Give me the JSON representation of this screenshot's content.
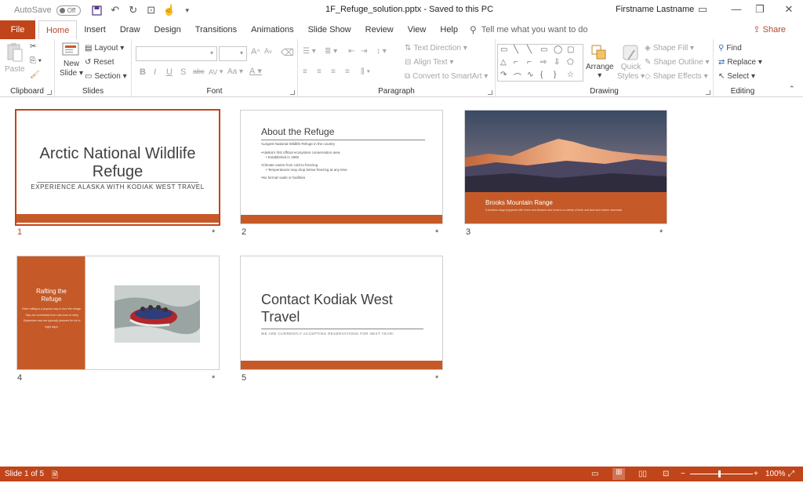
{
  "window": {
    "autosave_label": "AutoSave",
    "autosave_state": "Off",
    "document_title": "1F_Refuge_solution.pptx  -  Saved to this PC",
    "user_name": "Firstname Lastname"
  },
  "tabs": {
    "file": "File",
    "home": "Home",
    "insert": "Insert",
    "draw": "Draw",
    "design": "Design",
    "transitions": "Transitions",
    "animations": "Animations",
    "slideshow": "Slide Show",
    "review": "Review",
    "view": "View",
    "help": "Help",
    "tell_me": "Tell me what you want to do",
    "share": "Share"
  },
  "ribbon": {
    "clipboard": {
      "label": "Clipboard",
      "paste": "Paste"
    },
    "slides": {
      "label": "Slides",
      "new_slide_1": "New",
      "new_slide_2": "Slide",
      "layout": "Layout",
      "reset": "Reset",
      "section": "Section"
    },
    "font": {
      "label": "Font",
      "bold": "B",
      "italic": "I",
      "underline": "U",
      "shadow": "S",
      "strike": "abc",
      "spacing": "AV",
      "case": "Aa",
      "grow": "A",
      "shrink": "A"
    },
    "paragraph": {
      "label": "Paragraph",
      "text_direction": "Text Direction",
      "align_text": "Align Text",
      "convert_smartart": "Convert to SmartArt"
    },
    "drawing": {
      "label": "Drawing",
      "arrange": "Arrange",
      "quick_styles_1": "Quick",
      "quick_styles_2": "Styles",
      "shape_fill": "Shape Fill",
      "shape_outline": "Shape Outline",
      "shape_effects": "Shape Effects"
    },
    "editing": {
      "label": "Editing",
      "find": "Find",
      "replace": "Replace",
      "select": "Select"
    }
  },
  "slides": [
    {
      "number": "1",
      "title_line1": "Arctic National Wildlife",
      "title_line2": "Refuge",
      "subtitle": "EXPERIENCE ALASKA WITH KODIAK WEST TRAVEL"
    },
    {
      "number": "2",
      "title": "About the Refuge",
      "bullets": [
        "•Largest National Wildlife Refuge in the country",
        "•Alaska's first official ecosystem conservation area",
        "• Established in 1960",
        "•Climate varies from cold to freezing",
        "• Temperatures may drop below freezing at any time",
        "•No formal roads or facilities"
      ]
    },
    {
      "number": "3",
      "title": "Brooks Mountain Range",
      "subtitle": "A treeless range peppered with rivers and streams and home to a variety of birds and land and marine mammals"
    },
    {
      "number": "4",
      "title_line1": "Rafting the",
      "title_line2": "Refuge",
      "body": "River rafting is a popular way to tour the refuge. Trips are scheduled from mid-June to early September and are typically planned for six to eight days."
    },
    {
      "number": "5",
      "title_line1": "Contact Kodiak West",
      "title_line2": "Travel",
      "subtitle": "WE ARE CURRENTLY ACCEPTING RESERVATIONS FOR NEXT YEAR!"
    }
  ],
  "transition_marker": "*",
  "status": {
    "slide_info": "Slide 1 of 5",
    "zoom": "100%"
  },
  "colors": {
    "accent": "#c0451a",
    "slide_orange": "#c55a28"
  }
}
